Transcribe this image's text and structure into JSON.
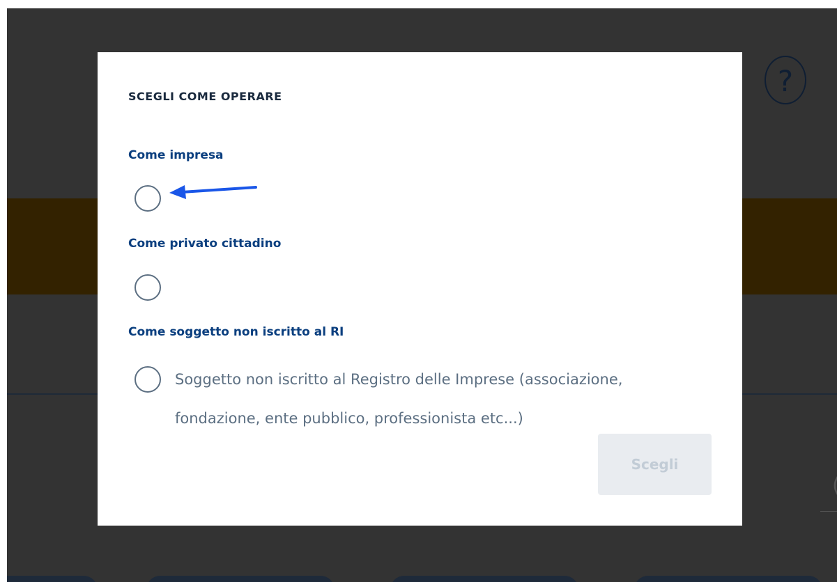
{
  "background": {
    "help_symbol": "?"
  },
  "modal": {
    "title": "SCEGLI COME OPERARE",
    "groups": [
      {
        "label": "Come impresa",
        "option_text": ""
      },
      {
        "label": "Come privato cittadino",
        "option_text": ""
      },
      {
        "label": "Come soggetto non iscritto al RI",
        "option_text": "Soggetto non iscritto al Registro delle Imprese (associazione, fondazione, ente pubblico, professionista etc...)"
      }
    ],
    "submit_label": "Scegli"
  },
  "colors": {
    "overlay": "#333333",
    "accent_band": "#332200",
    "label_blue": "#0b3f7f",
    "arrow_blue": "#1a56e8",
    "radio_gray": "#5c6f82",
    "disabled_button": "#e9ecf0"
  },
  "icons": {
    "help": "question-circle-icon",
    "annotation": "arrow-left-icon"
  }
}
